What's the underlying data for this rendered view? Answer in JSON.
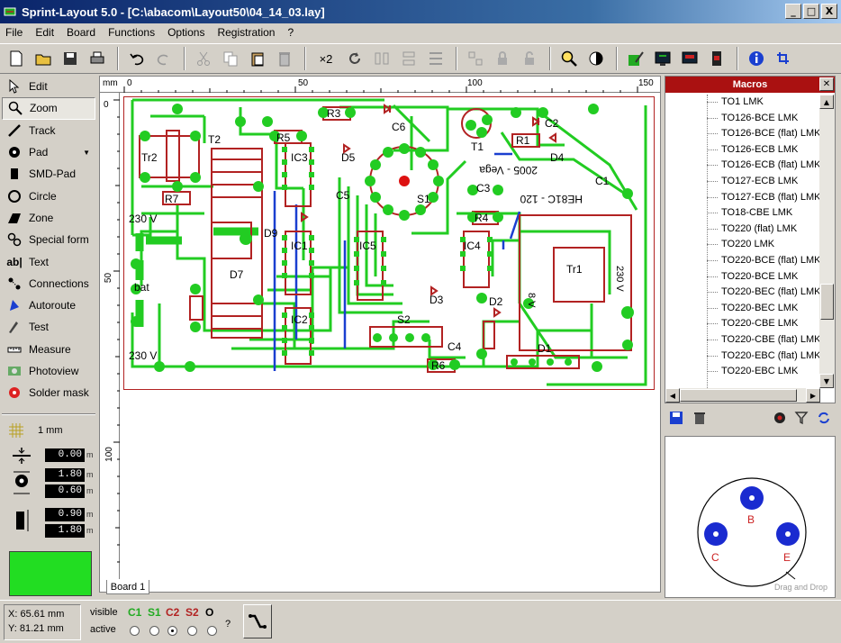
{
  "window": {
    "title": "Sprint-Layout 5.0 - [C:\\abacom\\Layout50\\04_14_03.lay]",
    "controls": {
      "minimize": "_",
      "maximize": "□",
      "close": "X"
    }
  },
  "menu": [
    "File",
    "Edit",
    "Board",
    "Functions",
    "Options",
    "Registration",
    "?"
  ],
  "toolbar": {
    "zoom_label": "×2"
  },
  "tools": [
    {
      "label": "Edit",
      "icon": "pointer-icon"
    },
    {
      "label": "Zoom",
      "icon": "magnifier-icon",
      "active": true
    },
    {
      "label": "Track",
      "icon": "track-icon"
    },
    {
      "label": "Pad",
      "icon": "pad-icon",
      "dropdown": true
    },
    {
      "label": "SMD-Pad",
      "icon": "smd-pad-icon"
    },
    {
      "label": "Circle",
      "icon": "circle-icon"
    },
    {
      "label": "Zone",
      "icon": "zone-icon"
    },
    {
      "label": "Special form",
      "icon": "special-form-icon"
    },
    {
      "label": "Text",
      "icon": "text-icon"
    },
    {
      "label": "Connections",
      "icon": "connections-icon"
    },
    {
      "label": "Autoroute",
      "icon": "autoroute-icon"
    },
    {
      "label": "Test",
      "icon": "test-icon"
    },
    {
      "label": "Measure",
      "icon": "measure-icon"
    },
    {
      "label": "Photoview",
      "icon": "photoview-icon"
    },
    {
      "label": "Solder mask",
      "icon": "solder-mask-icon"
    }
  ],
  "grid": {
    "label": "1 mm"
  },
  "params": {
    "track_width": "0.00",
    "pad_outer": "1.80",
    "pad_inner": "0.60",
    "smd_width": "0.90",
    "smd_height": "1.80",
    "unit": "m"
  },
  "colors": {
    "active_layer": "#22dd22",
    "copper_bottom": "#22cc22",
    "copper_top": "#b22222",
    "silk": "#b22222"
  },
  "ruler": {
    "top": [
      "mm",
      "0",
      "50",
      "100",
      "150"
    ],
    "left": [
      "0",
      "50",
      "100"
    ]
  },
  "board": {
    "tab": "Board 1",
    "labels": {
      "tr2": "Tr2",
      "t2": "T2",
      "r7": "R7",
      "v230a": "230 V",
      "d7": "D7",
      "bat": "bat",
      "v230b": "230 V",
      "r3": "R3",
      "r5": "R5",
      "c6": "C6",
      "d5": "D5",
      "ic3": "IC3",
      "c5": "C5",
      "d9": "D9",
      "ic1": "IC1",
      "ic2": "IC2",
      "s1": "S1",
      "ic5": "IC5",
      "t1": "T1",
      "r1": "R1",
      "c2": "C2",
      "d4": "D4",
      "c3": "C3",
      "r4": "R4",
      "c1": "C1",
      "ic4": "IC4",
      "d3": "D3",
      "d2": "D2",
      "s2": "S2",
      "c4": "C4",
      "r6": "R6",
      "d1": "D1",
      "tr1": "Tr1",
      "v230c": "230 V",
      "v8": "8 V",
      "mirror1": "2005 - Vega",
      "mirror2": "HE81C - 120"
    }
  },
  "macros": {
    "title": "Macros",
    "items": [
      "TO1 LMK",
      "TO126-BCE LMK",
      "TO126-BCE (flat) LMK",
      "TO126-ECB LMK",
      "TO126-ECB (flat) LMK",
      "TO127-ECB LMK",
      "TO127-ECB (flat) LMK",
      "TO18-CBE LMK",
      "TO220 (flat) LMK",
      "TO220 LMK",
      "TO220-BCE (flat) LMK",
      "TO220-BCE LMK",
      "TO220-BEC (flat) LMK",
      "TO220-BEC LMK",
      "TO220-CBE LMK",
      "TO220-CBE (flat) LMK",
      "TO220-EBC (flat) LMK",
      "TO220-EBC LMK"
    ],
    "preview": {
      "pins": [
        "B",
        "C",
        "E"
      ],
      "hint": "Drag and Drop"
    }
  },
  "status": {
    "x_label": "X:",
    "x_value": "65.61 mm",
    "y_label": "Y:",
    "y_value": "81.21 mm",
    "visible_label": "visible",
    "active_label": "active",
    "layers": [
      "C1",
      "S1",
      "C2",
      "S2",
      "O"
    ],
    "help": "?"
  }
}
